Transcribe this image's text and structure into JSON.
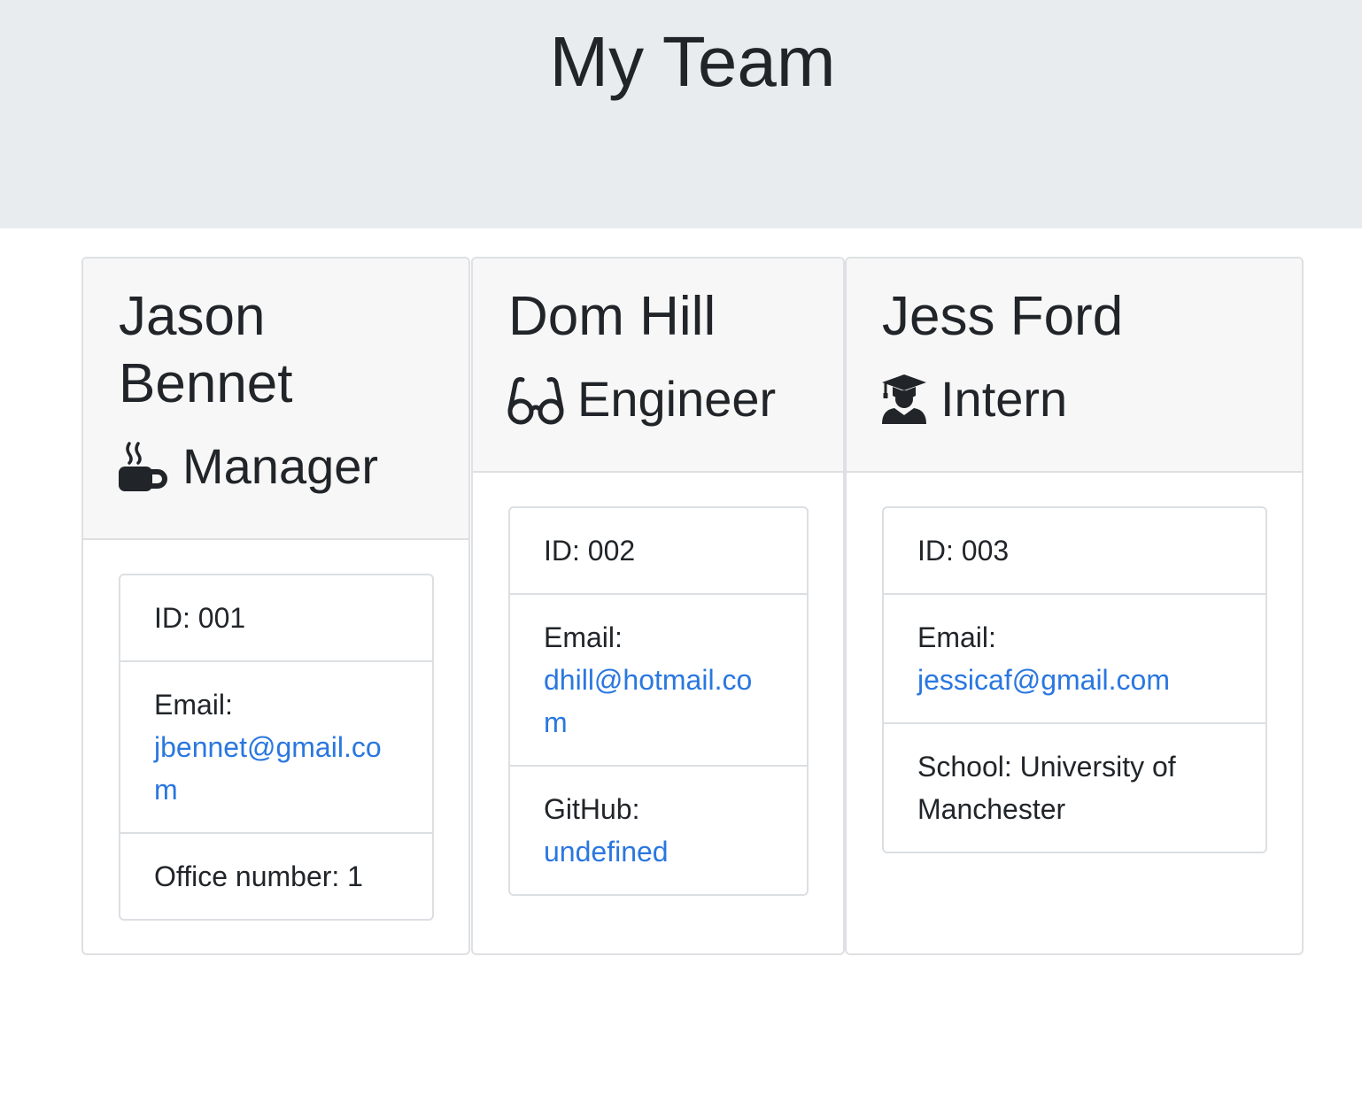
{
  "page": {
    "title": "My Team"
  },
  "team": [
    {
      "name": "Jason Bennet",
      "role": "Manager",
      "role_icon": "coffee-mug-icon",
      "id_label": "ID: 001",
      "email_label": "Email:",
      "email": "jbennet@gmail.com",
      "extra_label": "Office number: 1"
    },
    {
      "name": "Dom Hill",
      "role": "Engineer",
      "role_icon": "glasses-icon",
      "id_label": "ID: 002",
      "email_label": "Email:",
      "email": "dhill@hotmail.com",
      "extra_label": "GitHub:",
      "extra_link": "undefined"
    },
    {
      "name": "Jess Ford",
      "role": "Intern",
      "role_icon": "graduate-icon",
      "id_label": "ID: 003",
      "email_label": "Email:",
      "email": "jessicaf@gmail.com",
      "extra_label": "School: University of Manchester"
    }
  ],
  "colors": {
    "header_bg": "#e9ecef",
    "card_header_bg": "#f7f7f7",
    "link": "#2a77e0",
    "text": "#212529"
  }
}
